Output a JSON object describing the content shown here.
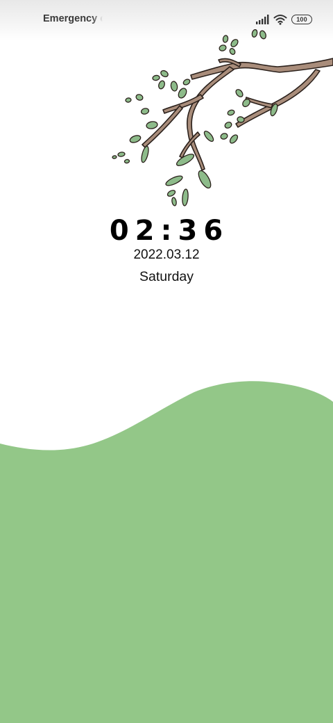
{
  "status_bar": {
    "carrier_text": "Emergency calls only",
    "battery_level": "100",
    "icons": [
      "signal-icon",
      "wifi-icon",
      "battery-icon"
    ]
  },
  "lock_screen": {
    "time": "02:36",
    "date": "2022.03.12",
    "weekday": "Saturday"
  },
  "wallpaper": {
    "theme": "tree-branch-and-green-hill",
    "hill_color": "#93c788",
    "leaf_color": "#8dbb8a",
    "branch_color": "#a98d7b"
  }
}
